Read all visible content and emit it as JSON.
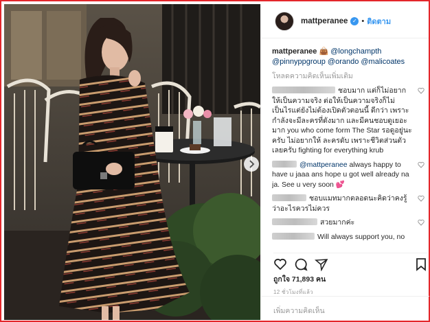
{
  "post": {
    "username": "mattperanee",
    "follow_label": "ติดตาม",
    "separator": "•"
  },
  "caption": {
    "username": "mattperanee",
    "emoji": "👜",
    "mentions": [
      "@longchampth",
      "@pinnyppgroup",
      "@orando",
      "@malicoates"
    ]
  },
  "load_more_label": "โหลดความคิดเห็นเพิ่มเติม",
  "comments": [
    {
      "text": "ชอบมาก แต่ก็ไม่อยากให้เป็นความจริง ต่อให้เป็นความจริงก็ไม่เป็นไรแต่ยังไม่ต้องเปิดตัวตอนนี้ ดีกว่า เพราะ กำลังจะมีละครที่ดังมาก และมีคนชอบดูเยอะมาก you who come form The Star รอดูอยู่นะครับ ไม่อยากให้ ละครดับ เพราะชีวิตส่วนตัวเลยครับ fighting for everything krub",
      "mention": ""
    },
    {
      "text": " always happy to have u jaaa ans hope u got well already na ja. See u very soon 💕",
      "mention": "@mattperanee"
    },
    {
      "text": "ชอบแมทมากตลอดนะคิดว่าคงรู้ว่าอะไรควรไม่ควร",
      "mention": ""
    },
    {
      "text": "สวยมากค่ะ",
      "mention": ""
    },
    {
      "text": "Will always support you, no",
      "mention": ""
    }
  ],
  "likes": {
    "prefix": "ถูกใจ",
    "count": "71,893",
    "suffix": "คน"
  },
  "timestamp": "12 ชั่วโมงที่แล้ว",
  "add_comment_placeholder": "เพิ่มความคิดเห็น",
  "colors": {
    "frame": "#e3262b",
    "link": "#3897f0",
    "mention": "#003569"
  }
}
